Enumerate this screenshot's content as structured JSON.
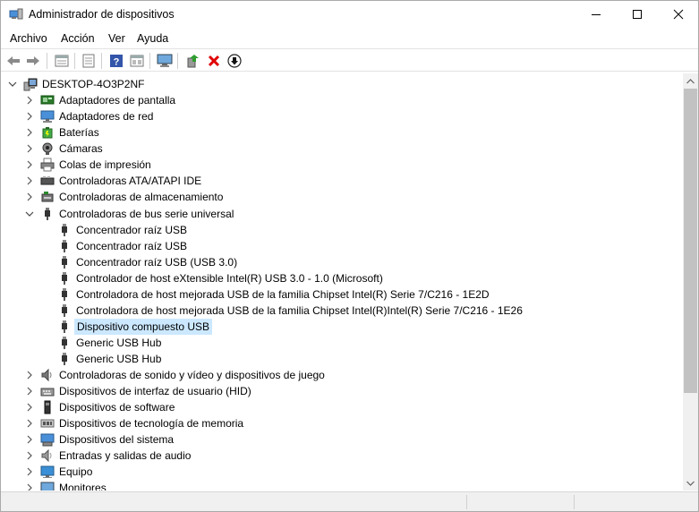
{
  "window": {
    "title": "Administrador de dispositivos",
    "controls": [
      "minimize",
      "maximize",
      "close"
    ]
  },
  "menu": {
    "items": [
      "Archivo",
      "Acción",
      "Ver",
      "Ayuda"
    ]
  },
  "toolbar": {
    "buttons": [
      {
        "name": "back-icon"
      },
      {
        "name": "forward-icon"
      },
      {
        "name": "properties-icon"
      },
      {
        "name": "print-icon"
      },
      {
        "name": "help-icon"
      },
      {
        "name": "view-icon"
      },
      {
        "name": "monitor-icon"
      },
      {
        "name": "update-driver-icon"
      },
      {
        "name": "uninstall-icon"
      },
      {
        "name": "disable-device-icon"
      }
    ]
  },
  "tree": {
    "root": "DESKTOP-4O3P2NF",
    "categories_before": [
      {
        "label": "Adaptadores de pantalla",
        "icon": "display-adapter-icon"
      },
      {
        "label": "Adaptadores de red",
        "icon": "network-adapter-icon"
      },
      {
        "label": "Baterías",
        "icon": "battery-icon"
      },
      {
        "label": "Cámaras",
        "icon": "camera-icon"
      },
      {
        "label": "Colas de impresión",
        "icon": "printer-icon"
      },
      {
        "label": "Controladoras ATA/ATAPI IDE",
        "icon": "ide-controller-icon"
      },
      {
        "label": "Controladoras de almacenamiento",
        "icon": "storage-controller-icon"
      }
    ],
    "expanded_category": {
      "label": "Controladoras de bus serie universal",
      "icon": "usb-icon"
    },
    "usb_children": [
      "Concentrador raíz USB",
      "Concentrador raíz USB",
      "Concentrador raíz USB (USB 3.0)",
      "Controlador de host eXtensible Intel(R) USB 3.0 - 1.0 (Microsoft)",
      "Controladora de host mejorada USB de la familia Chipset Intel(R) Serie 7/C216 - 1E2D",
      "Controladora de host mejorada USB de la familia Chipset Intel(R)Intel(R) Serie 7/C216 - 1E26",
      "Dispositivo compuesto USB",
      "Generic USB Hub",
      "Generic USB Hub"
    ],
    "selected_child": "Dispositivo compuesto USB",
    "categories_after": [
      {
        "label": "Controladoras de sonido y vídeo y dispositivos de juego",
        "icon": "sound-icon"
      },
      {
        "label": "Dispositivos de interfaz de usuario (HID)",
        "icon": "hid-icon"
      },
      {
        "label": "Dispositivos de software",
        "icon": "software-device-icon"
      },
      {
        "label": "Dispositivos de tecnología de memoria",
        "icon": "memory-icon"
      },
      {
        "label": "Dispositivos del sistema",
        "icon": "system-device-icon"
      },
      {
        "label": "Entradas y salidas de audio",
        "icon": "audio-io-icon"
      },
      {
        "label": "Equipo",
        "icon": "computer-icon"
      },
      {
        "label": "Monitores",
        "icon": "monitor-icon"
      }
    ]
  },
  "colors": {
    "selection": "#cce8ff",
    "uninstall_red": "#e00000",
    "help_blue": "#3355aa"
  }
}
